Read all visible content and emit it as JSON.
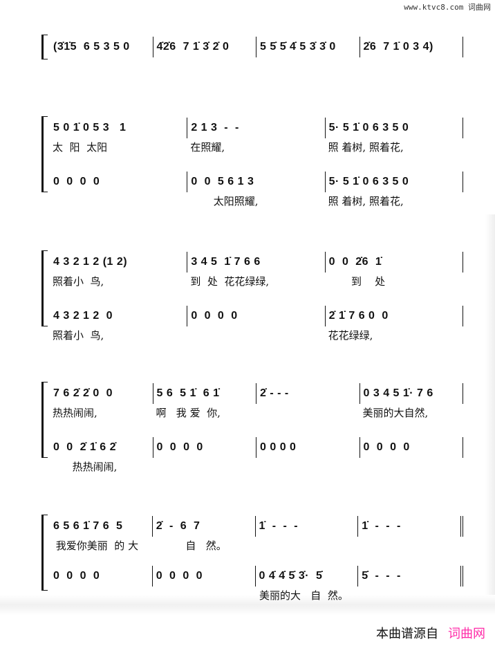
{
  "watermark_top": {
    "url": "www.ktvc8.com",
    "site": "词曲网"
  },
  "watermark_bottom": {
    "prefix": "本曲谱源自",
    "site": "词曲网",
    "site_color": "#ff2aa8"
  },
  "intro": {
    "measures": [
      "(3̇1̇5  6 5 3 5 0",
      "4̇2̇6  7 1̇ 3̇ 2̇ 0",
      "5 5̇ 5̇ 4̇ 5 3̇ 3̇ 0",
      "2̇6  7 1̇ 0 3 4)"
    ]
  },
  "systems": [
    {
      "staves": [
        {
          "measures": [
            "5 0 1̇ 0 5 3   1",
            "2 1 3  -  -",
            "5· 5 1̇ 0 6 3 5 0"
          ],
          "lyrics": [
            "太  阳  太阳",
            "在照耀,",
            "照 着树, 照着花,"
          ]
        },
        {
          "measures": [
            "0  0  0  0",
            "0  0  5 6 1 3",
            "5· 5 1̇ 0 6 3 5 0"
          ],
          "lyrics": [
            "",
            "       太阳照耀,",
            "照 着树, 照着花,"
          ]
        }
      ]
    },
    {
      "staves": [
        {
          "measures": [
            "4 3 2 1 2 (1 2)",
            "3 4 5  1̇ 7 6 6",
            "0  0  2̇6  1̇"
          ],
          "lyrics": [
            "照着小  鸟,",
            "到  处  花花绿绿,",
            "       到    处"
          ]
        },
        {
          "measures": [
            "4 3 2 1 2  0",
            "0  0  0  0",
            "2̇ 1̇ 7 6 0  0"
          ],
          "lyrics": [
            "照着小  鸟,",
            "",
            "花花绿绿,"
          ]
        }
      ]
    },
    {
      "staves": [
        {
          "measures": [
            "7 6 2̇ 2̇ 0  0",
            "5 6  5 1̇  6 1̇",
            "2̇ - - -",
            "0 3 4 5 1̇· 7 6"
          ],
          "lyrics": [
            "热热闹闹,",
            "啊   我 爱  你,",
            "",
            "美丽的大自然,"
          ]
        },
        {
          "measures": [
            "0  0  2̇ 1̇ 6 2̇",
            "0  0  0  0",
            "0 0 0 0",
            "0  0  0  0"
          ],
          "lyrics": [
            "      热热闹闹,",
            "",
            "",
            ""
          ]
        }
      ]
    },
    {
      "staves": [
        {
          "measures": [
            "6 5 6 1̇ 7 6  5",
            "2̇  -  6  7",
            "1̇  -  -  -",
            "1̇  -  -  -"
          ],
          "lyrics": [
            " 我爱你美丽  的 大",
            "         自   然。",
            "",
            ""
          ]
        },
        {
          "measures": [
            "0  0  0  0",
            "0  0  0  0",
            "0 4̇ 4̇ 5̇ 3̇·  5̇",
            "5̇  -  -  -"
          ],
          "lyrics": [
            "",
            "",
            "美丽的大   自  然。",
            ""
          ]
        }
      ]
    }
  ]
}
